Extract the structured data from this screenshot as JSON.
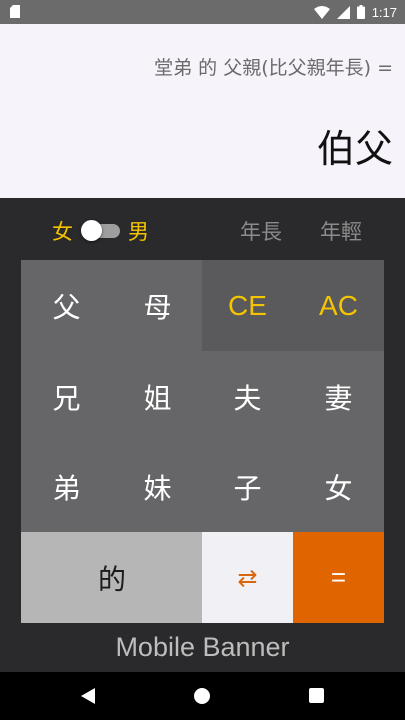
{
  "status_bar": {
    "time": "1:17"
  },
  "display": {
    "expression": "堂弟 的 父親(比父親年長) =",
    "result": "伯父"
  },
  "options": {
    "gender_female": "女",
    "gender_male": "男",
    "age_older": "年長",
    "age_younger": "年輕"
  },
  "keys": {
    "father": "父",
    "mother": "母",
    "clear_entry": "CE",
    "all_clear": "AC",
    "older_brother": "兄",
    "older_sister": "姐",
    "husband": "夫",
    "wife": "妻",
    "younger_brother": "弟",
    "younger_sister": "妹",
    "son": "子",
    "daughter": "女",
    "of": "的",
    "swap": "⇄",
    "equals": "="
  },
  "banner": {
    "text": "Mobile Banner"
  }
}
